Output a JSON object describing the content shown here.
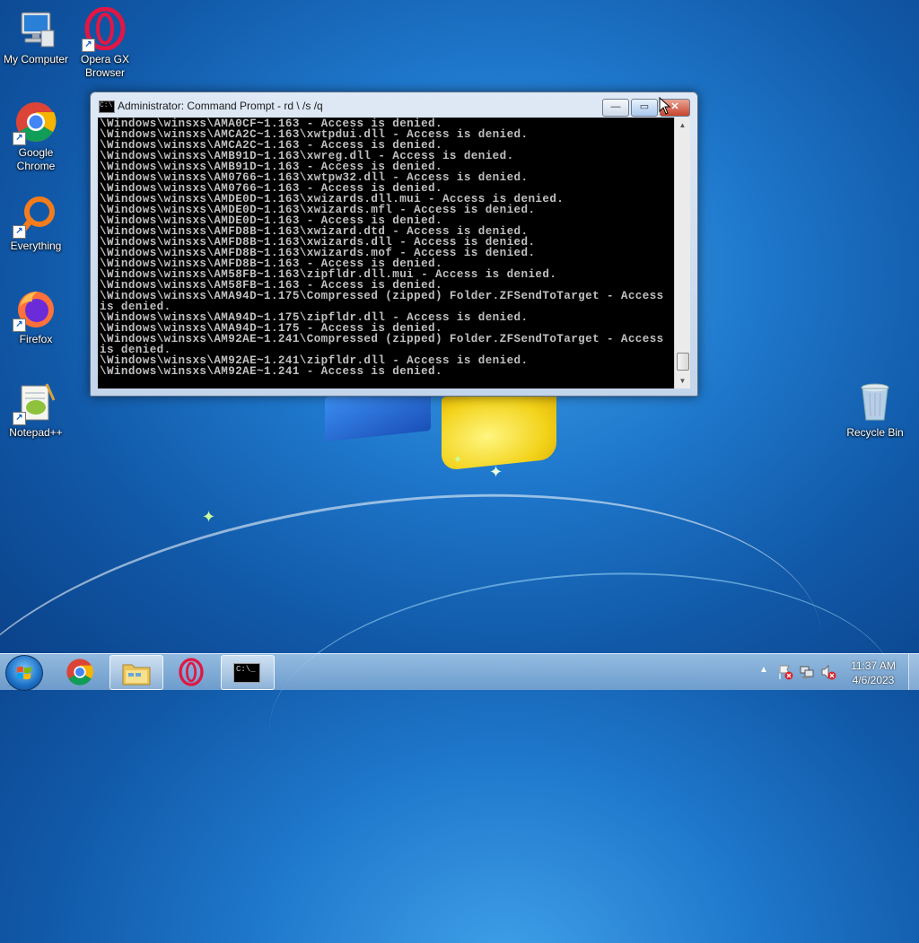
{
  "desktop": {
    "icons": [
      {
        "label": "My Computer",
        "icon": "computer-icon"
      },
      {
        "label": "Opera GX Browser",
        "icon": "opera-gx-icon"
      },
      {
        "label": "Google Chrome",
        "icon": "chrome-icon"
      },
      {
        "label": "Everything",
        "icon": "everything-icon"
      },
      {
        "label": "Firefox",
        "icon": "firefox-icon"
      },
      {
        "label": "Notepad++",
        "icon": "notepadpp-icon"
      },
      {
        "label": "Recycle Bin",
        "icon": "recycle-bin-icon"
      }
    ]
  },
  "window": {
    "title": "Administrator:  Command Prompt - rd \\ /s /q",
    "minimize_label": "—",
    "maximize_label": "▭",
    "close_label": "✕",
    "console_lines": [
      "\\Windows\\winsxs\\AMA0CF~1.163 - Access is denied.",
      "\\Windows\\winsxs\\AMCA2C~1.163\\xwtpdui.dll - Access is denied.",
      "\\Windows\\winsxs\\AMCA2C~1.163 - Access is denied.",
      "\\Windows\\winsxs\\AMB91D~1.163\\xwreg.dll - Access is denied.",
      "\\Windows\\winsxs\\AMB91D~1.163 - Access is denied.",
      "\\Windows\\winsxs\\AM0766~1.163\\xwtpw32.dll - Access is denied.",
      "\\Windows\\winsxs\\AM0766~1.163 - Access is denied.",
      "\\Windows\\winsxs\\AMDE0D~1.163\\xwizards.dll.mui - Access is denied.",
      "\\Windows\\winsxs\\AMDE0D~1.163\\xwizards.mfl - Access is denied.",
      "\\Windows\\winsxs\\AMDE0D~1.163 - Access is denied.",
      "\\Windows\\winsxs\\AMFD8B~1.163\\xwizard.dtd - Access is denied.",
      "\\Windows\\winsxs\\AMFD8B~1.163\\xwizards.dll - Access is denied.",
      "\\Windows\\winsxs\\AMFD8B~1.163\\xwizards.mof - Access is denied.",
      "\\Windows\\winsxs\\AMFD8B~1.163 - Access is denied.",
      "\\Windows\\winsxs\\AM58FB~1.163\\zipfldr.dll.mui - Access is denied.",
      "\\Windows\\winsxs\\AM58FB~1.163 - Access is denied.",
      "\\Windows\\winsxs\\AMA94D~1.175\\Compressed (zipped) Folder.ZFSendToTarget - Access",
      "is denied.",
      "\\Windows\\winsxs\\AMA94D~1.175\\zipfldr.dll - Access is denied.",
      "\\Windows\\winsxs\\AMA94D~1.175 - Access is denied.",
      "\\Windows\\winsxs\\AM92AE~1.241\\Compressed (zipped) Folder.ZFSendToTarget - Access",
      "is denied.",
      "\\Windows\\winsxs\\AM92AE~1.241\\zipfldr.dll - Access is denied.",
      "\\Windows\\winsxs\\AM92AE~1.241 - Access is denied."
    ]
  },
  "taskbar": {
    "items": [
      {
        "name": "chrome-taskbar-button",
        "icon": "chrome-icon"
      },
      {
        "name": "explorer-taskbar-button",
        "icon": "folder-icon"
      },
      {
        "name": "opera-taskbar-button",
        "icon": "opera-icon"
      },
      {
        "name": "cmd-taskbar-button",
        "icon": "cmd-icon",
        "label": "C:\\_"
      }
    ],
    "tray": {
      "time": "11:37 AM",
      "date": "4/6/2023"
    }
  },
  "colors": {
    "console_bg": "#000000",
    "console_fg": "#c0c0c0",
    "close_red": "#c8442b"
  }
}
